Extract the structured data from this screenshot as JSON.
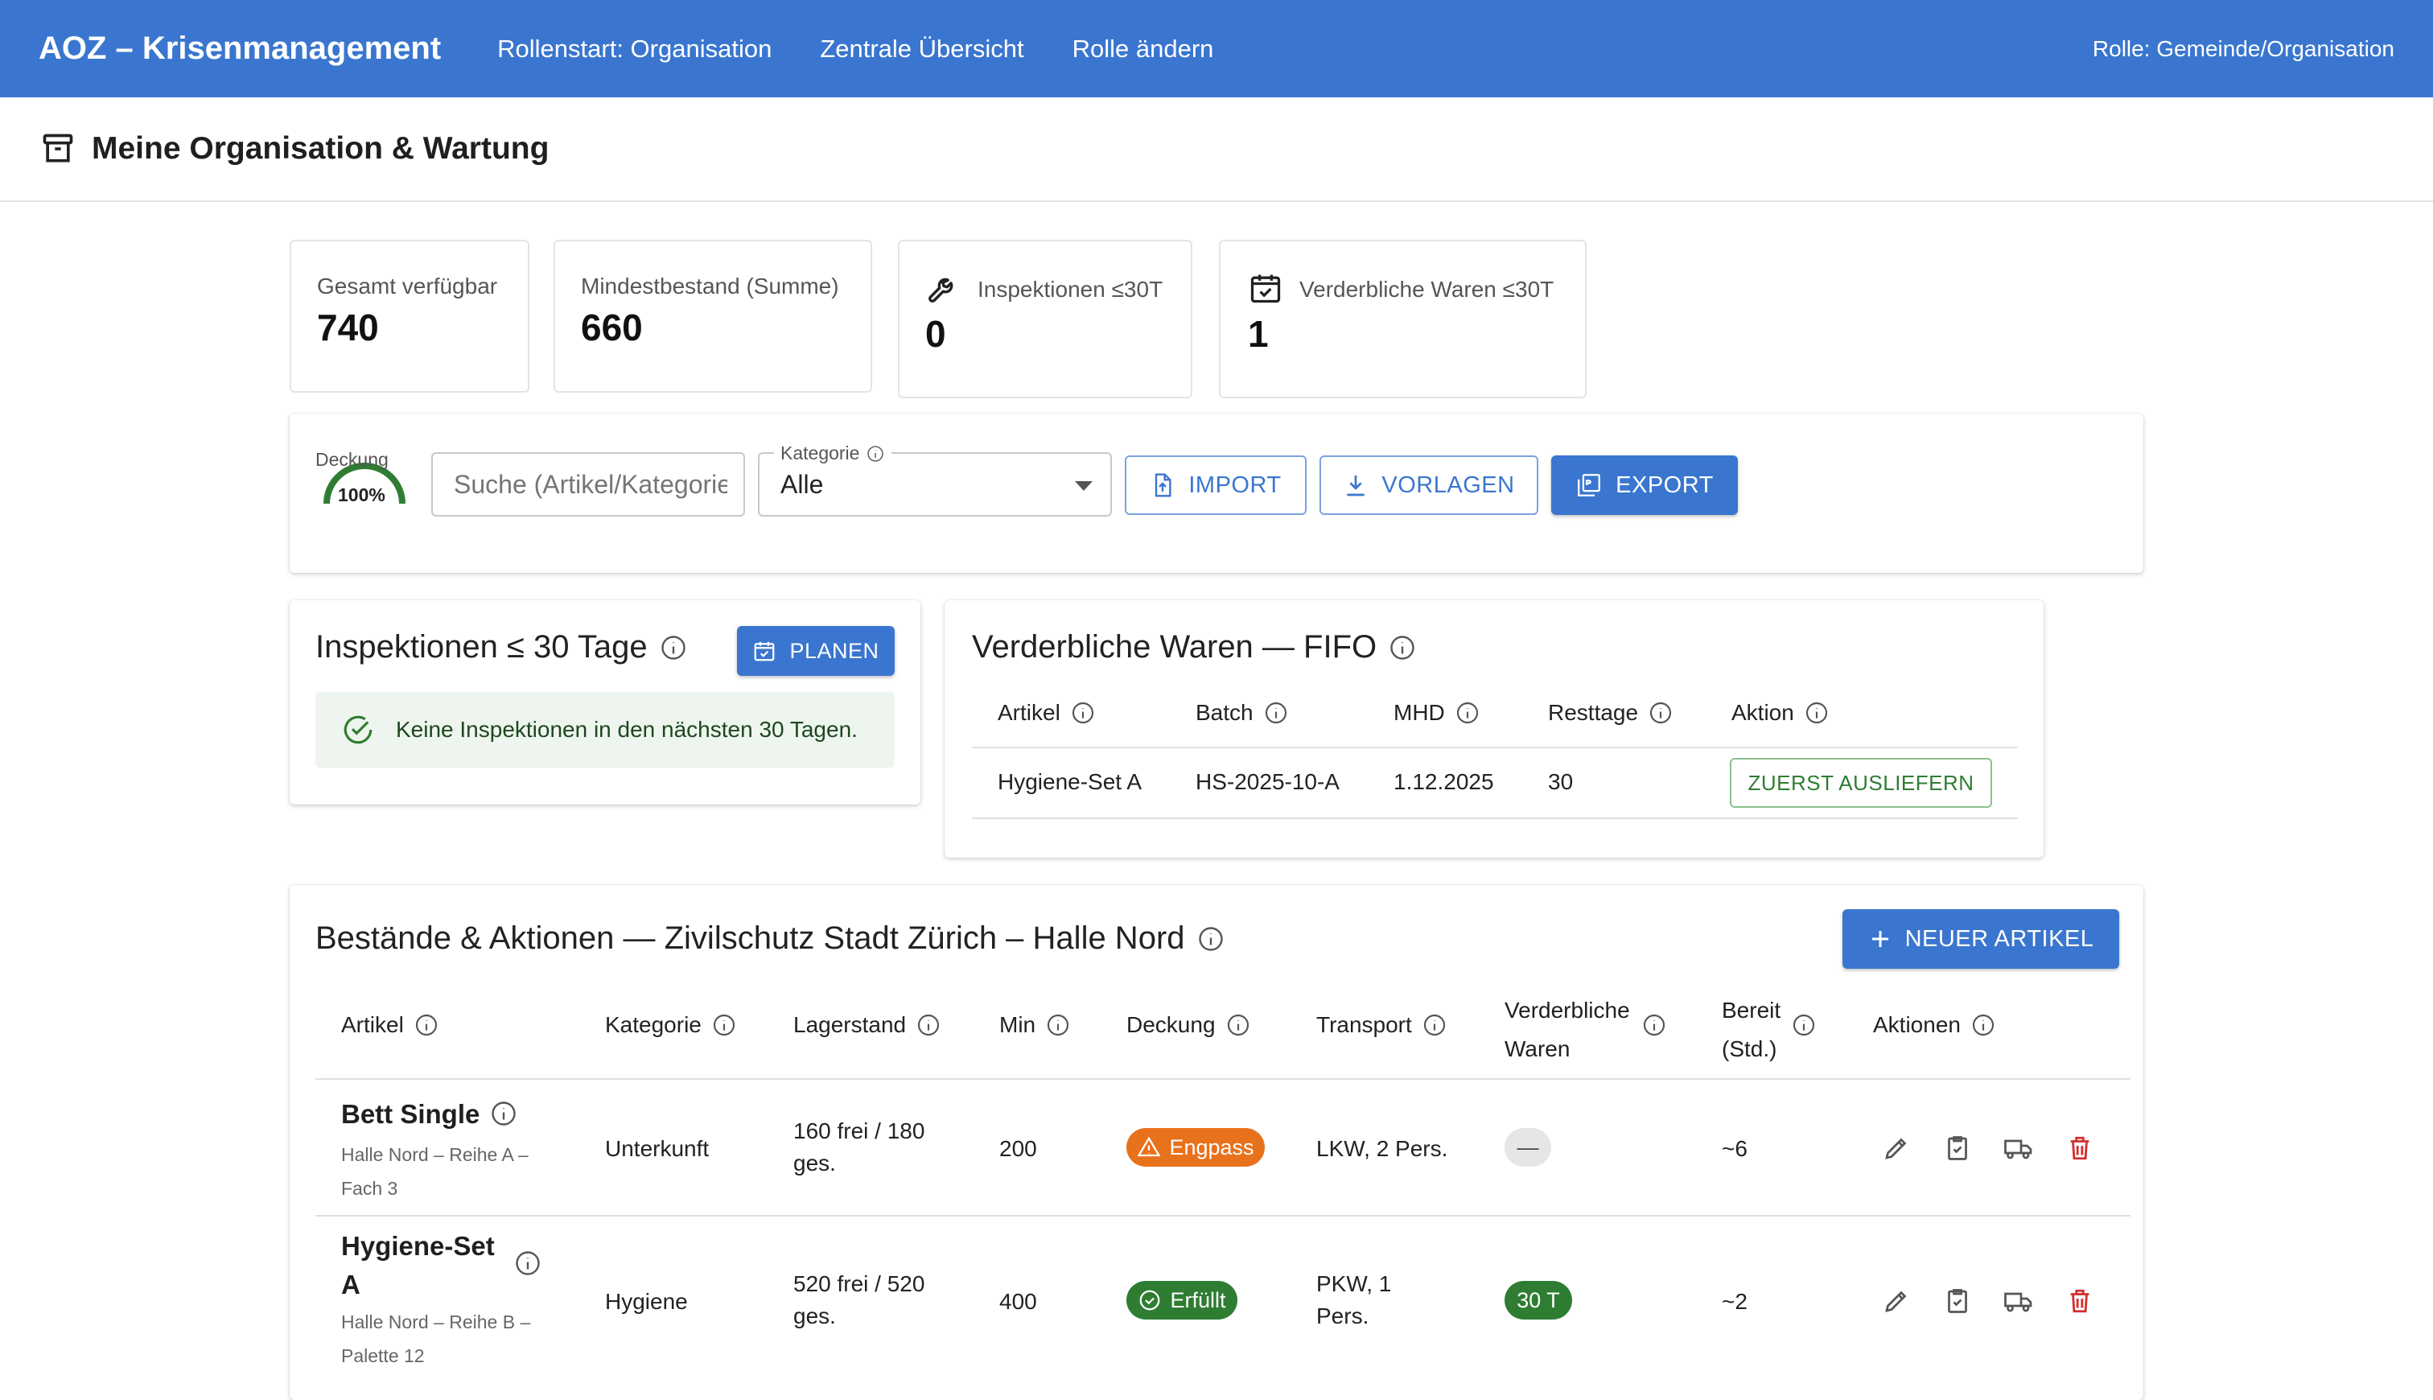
{
  "appbar": {
    "brand": "AOZ – Krisenmanagement",
    "nav": [
      "Rollenstart: Organisation",
      "Zentrale Übersicht",
      "Rolle ändern"
    ],
    "role": "Rolle: Gemeinde/Organisation"
  },
  "page": {
    "title": "Meine Organisation & Wartung",
    "icon": "archive-box-icon"
  },
  "kpis": [
    {
      "label": "Gesamt verfügbar",
      "value": "740"
    },
    {
      "label": "Mindestbestand (Summe)",
      "value": "660"
    },
    {
      "label": "Inspektionen ≤30T",
      "value": "0",
      "icon": "wrench-icon"
    },
    {
      "label": "Verderbliche Waren ≤30T",
      "value": "1",
      "icon": "calendar-check-icon"
    }
  ],
  "toolbar": {
    "coverage_label": "Deckung",
    "coverage_value": "100%",
    "coverage_fraction": 1.0,
    "search_placeholder": "Suche (Artikel/Kategorie)",
    "category_label": "Kategorie",
    "category_value": "Alle",
    "import_label": "IMPORT",
    "templates_label": "VORLAGEN",
    "export_label": "EXPORT"
  },
  "inspections": {
    "title": "Inspektionen ≤ 30 Tage",
    "plan_label": "PLANEN",
    "empty_message": "Keine Inspektionen in den nächsten 30 Tagen."
  },
  "fifo": {
    "title": "Verderbliche Waren — FIFO",
    "columns": [
      "Artikel",
      "Batch",
      "MHD",
      "Resttage",
      "Aktion"
    ],
    "rows": [
      {
        "artikel": "Hygiene-Set A",
        "batch": "HS-2025-10-A",
        "mhd": "1.12.2025",
        "resttage": "30",
        "action": "ZUERST AUSLIEFERN"
      }
    ]
  },
  "stock": {
    "title": "Bestände & Aktionen — Zivilschutz Stadt Zürich – Halle Nord",
    "new_label": "NEUER ARTIKEL",
    "columns": {
      "artikel": "Artikel",
      "kategorie": "Kategorie",
      "lagerstand": "Lagerstand",
      "min": "Min",
      "deckung": "Deckung",
      "transport": "Transport",
      "verderblich_1": "Verderbliche",
      "verderblich_2": "Waren",
      "bereit_1": "Bereit",
      "bereit_2": "(Std.)",
      "aktionen": "Aktionen"
    },
    "rows": [
      {
        "name": "Bett Single",
        "location_1": "Halle Nord – Reihe A –",
        "location_2": "Fach 3",
        "kategorie": "Unterkunft",
        "lager_1": "160 frei / 180",
        "lager_2": "ges.",
        "min": "200",
        "deckung": "Engpass",
        "deckung_color": "#e8711c",
        "transport_1": "LKW, 2 Pers.",
        "transport_2": "",
        "verderblich": "—",
        "bereit": "~6"
      },
      {
        "name_1": "Hygiene-Set",
        "name_2": "A",
        "location_1": "Halle Nord – Reihe B –",
        "location_2": "Palette 12",
        "kategorie": "Hygiene",
        "lager_1": "520 frei / 520",
        "lager_2": "ges.",
        "min": "400",
        "deckung": "Erfüllt",
        "deckung_color": "#2e7d32",
        "transport_1": "PKW, 1",
        "transport_2": "Pers.",
        "verderblich": "30 T",
        "bereit": "~2"
      }
    ]
  },
  "colors": {
    "primary": "#3a76cf",
    "success": "#2e7d32",
    "warning": "#e8711c",
    "danger": "#d32f2f"
  }
}
